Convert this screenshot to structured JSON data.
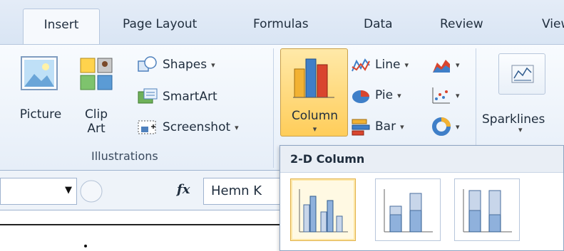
{
  "tabs": [
    "Insert",
    "Page Layout",
    "Formulas",
    "Data",
    "Review",
    "View"
  ],
  "illustrations": {
    "picture": "Picture",
    "clip_art_line1": "Clip",
    "clip_art_line2": "Art",
    "shapes": "Shapes",
    "smartart": "SmartArt",
    "screenshot": "Screenshot",
    "group_label": "Illustrations"
  },
  "charts": {
    "column": "Column",
    "line": "Line",
    "pie": "Pie",
    "bar": "Bar"
  },
  "sparklines": {
    "label": "Sparklines"
  },
  "formula_bar": {
    "fx": "fx",
    "value": "Hemn K"
  },
  "gallery": {
    "header": "2-D Column"
  },
  "colors": {
    "ribbon_bg": "#e6eef8",
    "pressed": "#ffcd5a",
    "accent_blue": "#4f81bd"
  }
}
